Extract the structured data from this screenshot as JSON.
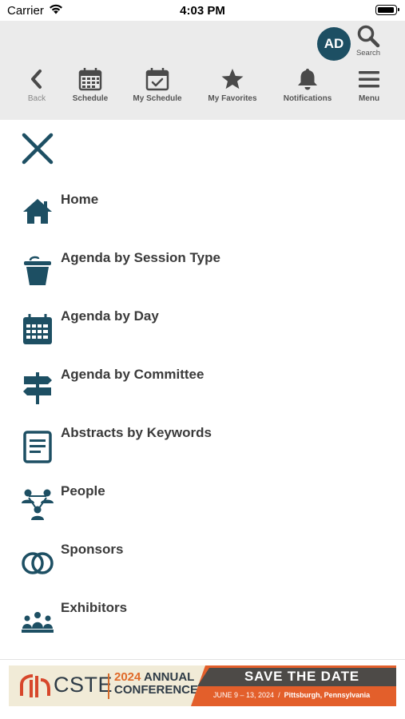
{
  "status_bar": {
    "carrier": "Carrier",
    "time": "4:03 PM"
  },
  "header": {
    "avatar_initials": "AD",
    "search_label": "Search",
    "toolbar": [
      {
        "label": "Back",
        "icon": "chevron-left-icon"
      },
      {
        "label": "Schedule",
        "icon": "calendar-icon"
      },
      {
        "label": "My Schedule",
        "icon": "calendar-check-icon"
      },
      {
        "label": "My Favorites",
        "icon": "star-icon"
      },
      {
        "label": "Notifications",
        "icon": "bell-icon"
      },
      {
        "label": "Menu",
        "icon": "hamburger-icon"
      }
    ]
  },
  "menu": {
    "close_icon": "close-icon",
    "items": [
      {
        "label": "Home",
        "icon": "home-icon"
      },
      {
        "label": "Agenda by Session Type",
        "icon": "bucket-icon"
      },
      {
        "label": "Agenda by Day",
        "icon": "calendar-icon"
      },
      {
        "label": "Agenda by Committee",
        "icon": "signpost-icon"
      },
      {
        "label": "Abstracts by Keywords",
        "icon": "document-icon"
      },
      {
        "label": "People",
        "icon": "people-icon"
      },
      {
        "label": "Sponsors",
        "icon": "interlocking-circles-icon"
      },
      {
        "label": "Exhibitors",
        "icon": "exhibitors-icon"
      }
    ]
  },
  "banner": {
    "brand": "CSTE",
    "year": "2024",
    "line1_rest": "ANNUAL",
    "line2": "CONFERENCE",
    "save_the_date": "SAVE THE DATE",
    "dates": "JUNE 9 – 13, 2024",
    "divider": "/",
    "location": "Pittsburgh, Pennsylvania"
  },
  "colors": {
    "accent": "#1d4f63",
    "header_bg": "#ebebeb",
    "icon_gray": "#555555",
    "banner_orange": "#e35f2b",
    "banner_dark": "#4d4a47"
  }
}
